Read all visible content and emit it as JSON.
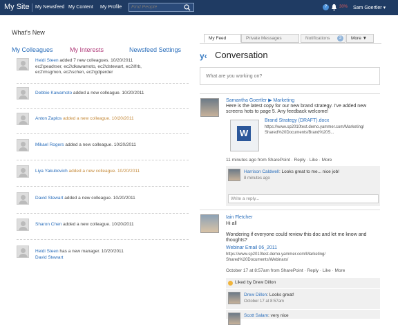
{
  "topbar": {
    "site_title": "My Site",
    "nav": [
      "My Newsfeed",
      "My Content",
      "My Profile"
    ],
    "search_placeholder": "Find People",
    "help_glyph": "?",
    "notification_count": "30%",
    "user_name": "Sam Goertler ▾"
  },
  "left": {
    "heading": "What's New",
    "tabs": [
      "My Colleagues",
      "My Interests",
      "Newsfeed Settings"
    ],
    "items": [
      {
        "line1_parts": [
          "Heidi Steen",
          " added 7 new colleagues.  10/20/2011"
        ],
        "line2": "ec2\\peadrser, ec2\\dkawamoto, ec2\\dstewart, ec2\\lfrb,",
        "line3": "ec2\\msgmon, ec2\\schen, ec2\\gdperder"
      },
      {
        "line1_parts": [
          "Debbie Kawamoto",
          " added a new colleague.  10/20/2011"
        ]
      },
      {
        "line1_parts": [
          "Anton Zaplos",
          " added a new colleague.  10/20/2011"
        ]
      },
      {
        "line1_parts": [
          "Mikael Rogers",
          " added a new colleague.  10/20/2011"
        ]
      },
      {
        "line1_parts": [
          "Liya Yakubovich",
          " added a new colleague.  10/20/2011"
        ]
      },
      {
        "line1_parts": [
          "David Stewart",
          " added a new colleague.  10/20/2011"
        ]
      },
      {
        "line1_parts": [
          "Sharon Chen",
          " added a new colleague.  10/20/2011"
        ]
      },
      {
        "line1_parts": [
          "Heidi Steen",
          " has a new manager.  10/20/2011"
        ],
        "line2": "David Stewart"
      }
    ]
  },
  "right": {
    "tabs": [
      "My Feed",
      "Private Messages",
      "Notifications",
      "More ▼"
    ],
    "notifications_badge": "3",
    "yammer_logo": "y‹",
    "conversation_title": "Conversation",
    "compose_placeholder": "What are you working on?",
    "post1": {
      "author": "Samantha Goertler ▶ Marketing",
      "text1": "Here is the latest copy for our new brand strategy. I've added new",
      "text2": "screens hots to page 5. Any feedback welcome!",
      "doc_title": "Brand Strategy (DRAFT).docx",
      "doc_url1": "https://www.sp2010test.demo.yammer.com/Marketing/",
      "doc_url2": "Shared%20Documents/Brand%20S...",
      "meta": "11 minutes ago from SharePoint · Reply · Like · More",
      "reply_author": "Harrison Caldwell",
      "reply_text": ": Looks great to me... nice job!",
      "reply_time": "8 minutes ago",
      "reply_placeholder": "Write a reply..."
    },
    "post2": {
      "author": "Iain Fletcher",
      "greeting": "Hi all",
      "text1": "Wondering if everyone could review this doc and let me know and",
      "text2": "thoughts?",
      "doc_title": "Webinar Email 06_2011",
      "doc_url1": "https://www.sp2010test.demo.yammer.com/Marketing/",
      "doc_url2": "Shared%20Documents/Webinars/",
      "meta": "October 17 at 8:57am from SharePoint · Reply · Like · More",
      "liked_by": "Liked by Drew Dillon",
      "reply1_author": "Drew Dillon",
      "reply1_text": ": Looks great!",
      "reply1_time": "October 17 at 8:57am",
      "reply2_author": "Scott Salam",
      "reply2_text": ": very nice"
    }
  },
  "colors": {
    "topbar": "#1f3b63",
    "link": "#2a6ebb",
    "interests": "#b03c7a"
  }
}
